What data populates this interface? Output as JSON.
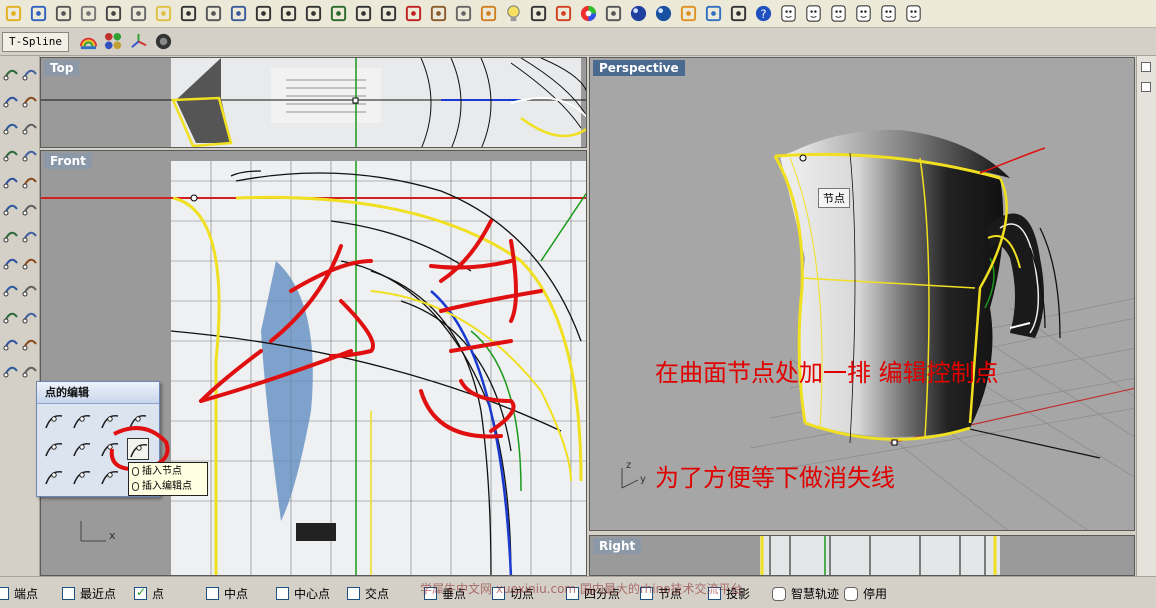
{
  "toolbar": {
    "tspline_label": "T-Spline",
    "icons": [
      "open-file-icon",
      "save-icon",
      "print-icon",
      "import-icon",
      "cut-icon",
      "copy-icon",
      "paste-icon",
      "undo-icon",
      "pan-hand-icon",
      "rotate-view-icon",
      "zoom-icon",
      "zoom-window-icon",
      "zoom-extents-icon",
      "zoom-selected-icon",
      "rotate-icon",
      "grid-viewports-icon",
      "car-icon",
      "cplane-icon",
      "set-view-icon",
      "osnap-icon",
      "light-bulb-icon",
      "lock-icon",
      "layer-icon",
      "color-wheel-icon",
      "wireframe-icon",
      "shaded-icon",
      "render-sphere-icon",
      "pen-icon",
      "settings-gear-icon",
      "toolbar-layout-icon",
      "help-icon",
      "face-1-icon",
      "face-2-icon",
      "face-3-icon",
      "face-4-icon",
      "face-5-icon",
      "face-6-icon"
    ]
  },
  "viewports": {
    "top": "Top",
    "front": "Front",
    "perspective": "Perspective",
    "right": "Right"
  },
  "popup": {
    "title": "点的编辑"
  },
  "tooltip": {
    "line1": "插入节点",
    "line2": "插入编辑点"
  },
  "perspective": {
    "knot_label": "节点",
    "annotation1": "在曲面节点处加一排  编辑控制点",
    "annotation2": "为了方便等下做消失线"
  },
  "osnap": [
    {
      "label": "端点",
      "checked": false
    },
    {
      "label": "最近点",
      "checked": false
    },
    {
      "label": "点",
      "checked": true
    },
    {
      "label": "中点",
      "checked": false
    },
    {
      "label": "中心点",
      "checked": false
    },
    {
      "label": "交点",
      "checked": false
    },
    {
      "label": "垂点",
      "checked": false
    },
    {
      "label": "切点",
      "checked": false
    },
    {
      "label": "四分点",
      "checked": false
    },
    {
      "label": "节点",
      "checked": false
    },
    {
      "label": "投影",
      "checked": false
    },
    {
      "label": "智慧轨迹",
      "checked": false
    },
    {
      "label": "停用",
      "checked": false
    }
  ],
  "watermark": "学犀牛中文网 xuexiniu.com 国内最大的rhino技术交流平台",
  "colors": {
    "accent": "#e00000",
    "viewport_title": "#4a6a90",
    "curve_yellow": "#f0e020"
  }
}
